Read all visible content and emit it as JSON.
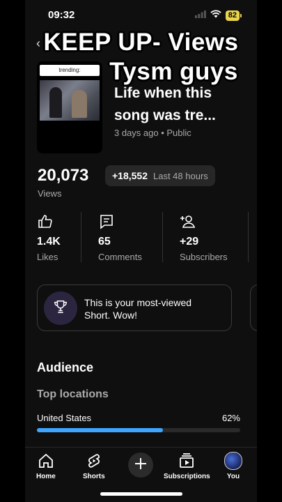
{
  "status": {
    "time": "09:32",
    "battery": "82"
  },
  "overlay": {
    "line1": "KEEP UP- Views",
    "line2": "Tysm guys"
  },
  "video": {
    "thumb_caption": "trending:",
    "title_line1": "Life when this",
    "title_line2": "song was tre...",
    "meta": "3 days ago • Public"
  },
  "views": {
    "count": "20,073",
    "label": "Views",
    "delta": "+18,552",
    "period": "Last 48 hours"
  },
  "stats": [
    {
      "value": "1.4K",
      "label": "Likes",
      "icon": "thumbs-up-icon"
    },
    {
      "value": "65",
      "label": "Comments",
      "icon": "comment-icon"
    },
    {
      "value": "+29",
      "label": "Subscribers",
      "icon": "add-person-icon"
    }
  ],
  "achievement": {
    "line1": "This is your most-viewed",
    "line2": "Short. Wow!",
    "icon": "trophy-icon"
  },
  "audience": {
    "title": "Audience",
    "top_locations": "Top locations",
    "location": "United States",
    "percent": "62%",
    "fraction": 0.62
  },
  "nav": {
    "home": "Home",
    "shorts": "Shorts",
    "subscriptions": "Subscriptions",
    "you": "You"
  },
  "colors": {
    "accent": "#3ea6ff",
    "battery": "#e8d44d",
    "background": "#0f0f0f"
  }
}
